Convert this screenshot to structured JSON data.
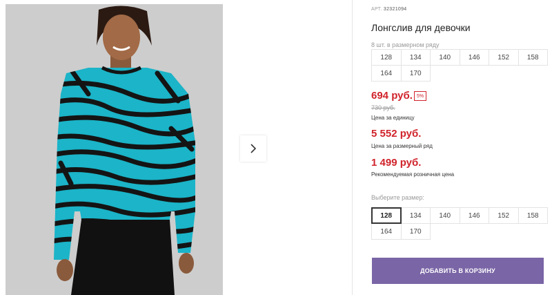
{
  "product": {
    "article_label": "АРТ.",
    "article_number": "32321094",
    "title": "Лонгслив для девочки"
  },
  "size_row": {
    "label": "8 шт. в размерном ряду",
    "sizes": [
      "128",
      "134",
      "140",
      "146",
      "152",
      "158",
      "164",
      "170"
    ]
  },
  "pricing": {
    "unit_price": "694 руб.",
    "discount": "5%",
    "old_price": "730 руб.",
    "unit_caption": "Цена за единицу",
    "row_price": "5 552 руб.",
    "row_caption": "Цена за размерный ряд",
    "retail_price": "1 499 руб.",
    "retail_caption": "Рекомендуемая розничная цена"
  },
  "size_select": {
    "label": "Выберите размер:",
    "sizes": [
      "128",
      "134",
      "140",
      "146",
      "152",
      "158",
      "164",
      "170"
    ],
    "selected": "128"
  },
  "cart_button": "ДОБАВИТЬ В КОРЗИНУ",
  "colors": {
    "price_red": "#d0232b",
    "button_purple": "#7a65a6",
    "shirt_teal": "#1bb4c8"
  },
  "icons": {
    "next_arrow": "chevron-right-icon"
  }
}
